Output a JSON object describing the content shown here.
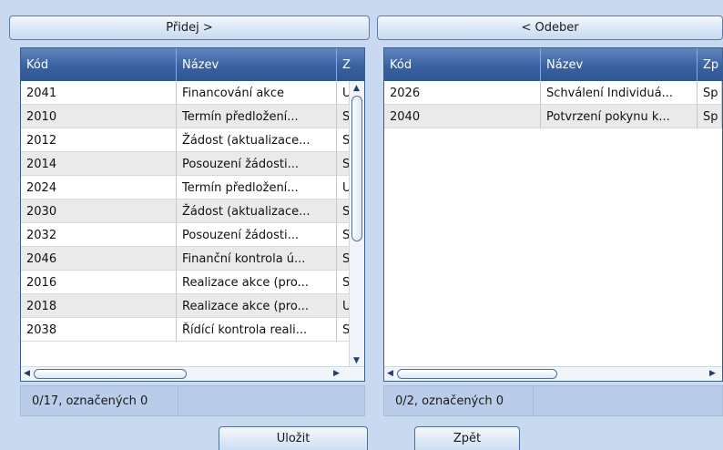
{
  "top_buttons": {
    "add": "Přidej >",
    "remove": "< Odeber"
  },
  "left_grid": {
    "columns": [
      "Kód",
      "Název",
      "Z"
    ],
    "rows": [
      [
        "2041",
        "Financování akce",
        "U"
      ],
      [
        "2010",
        "Termín předložení...",
        "S"
      ],
      [
        "2012",
        "Žádost (aktualizace...",
        "S"
      ],
      [
        "2014",
        "Posouzení žádosti...",
        "S"
      ],
      [
        "2024",
        "Termín předložení...",
        "U"
      ],
      [
        "2030",
        "Žádost (aktualizace...",
        "S"
      ],
      [
        "2032",
        "Posouzení žádosti...",
        "S"
      ],
      [
        "2046",
        "Finanční kontrola ú...",
        "S"
      ],
      [
        "2016",
        "Realizace akce (pro...",
        "S"
      ],
      [
        "2018",
        "Realizace akce (pro...",
        "U"
      ],
      [
        "2038",
        "Řídící kontrola reali...",
        "S"
      ]
    ]
  },
  "right_grid": {
    "columns": [
      "Kód",
      "Název",
      "Zp"
    ],
    "rows": [
      [
        "2026",
        "Schválení Individuá...",
        "Sp"
      ],
      [
        "2040",
        "Potvrzení pokynu k...",
        "Sp"
      ]
    ]
  },
  "status": {
    "left": "0/17, označených 0",
    "right": "0/2, označených 0"
  },
  "bottom_buttons": {
    "save": "Uložit",
    "back": "Zpět"
  },
  "icons": {
    "up": "scroll-up-arrow-icon",
    "down": "scroll-down-arrow-icon",
    "left": "scroll-left-arrow-icon",
    "right": "scroll-right-arrow-icon"
  }
}
